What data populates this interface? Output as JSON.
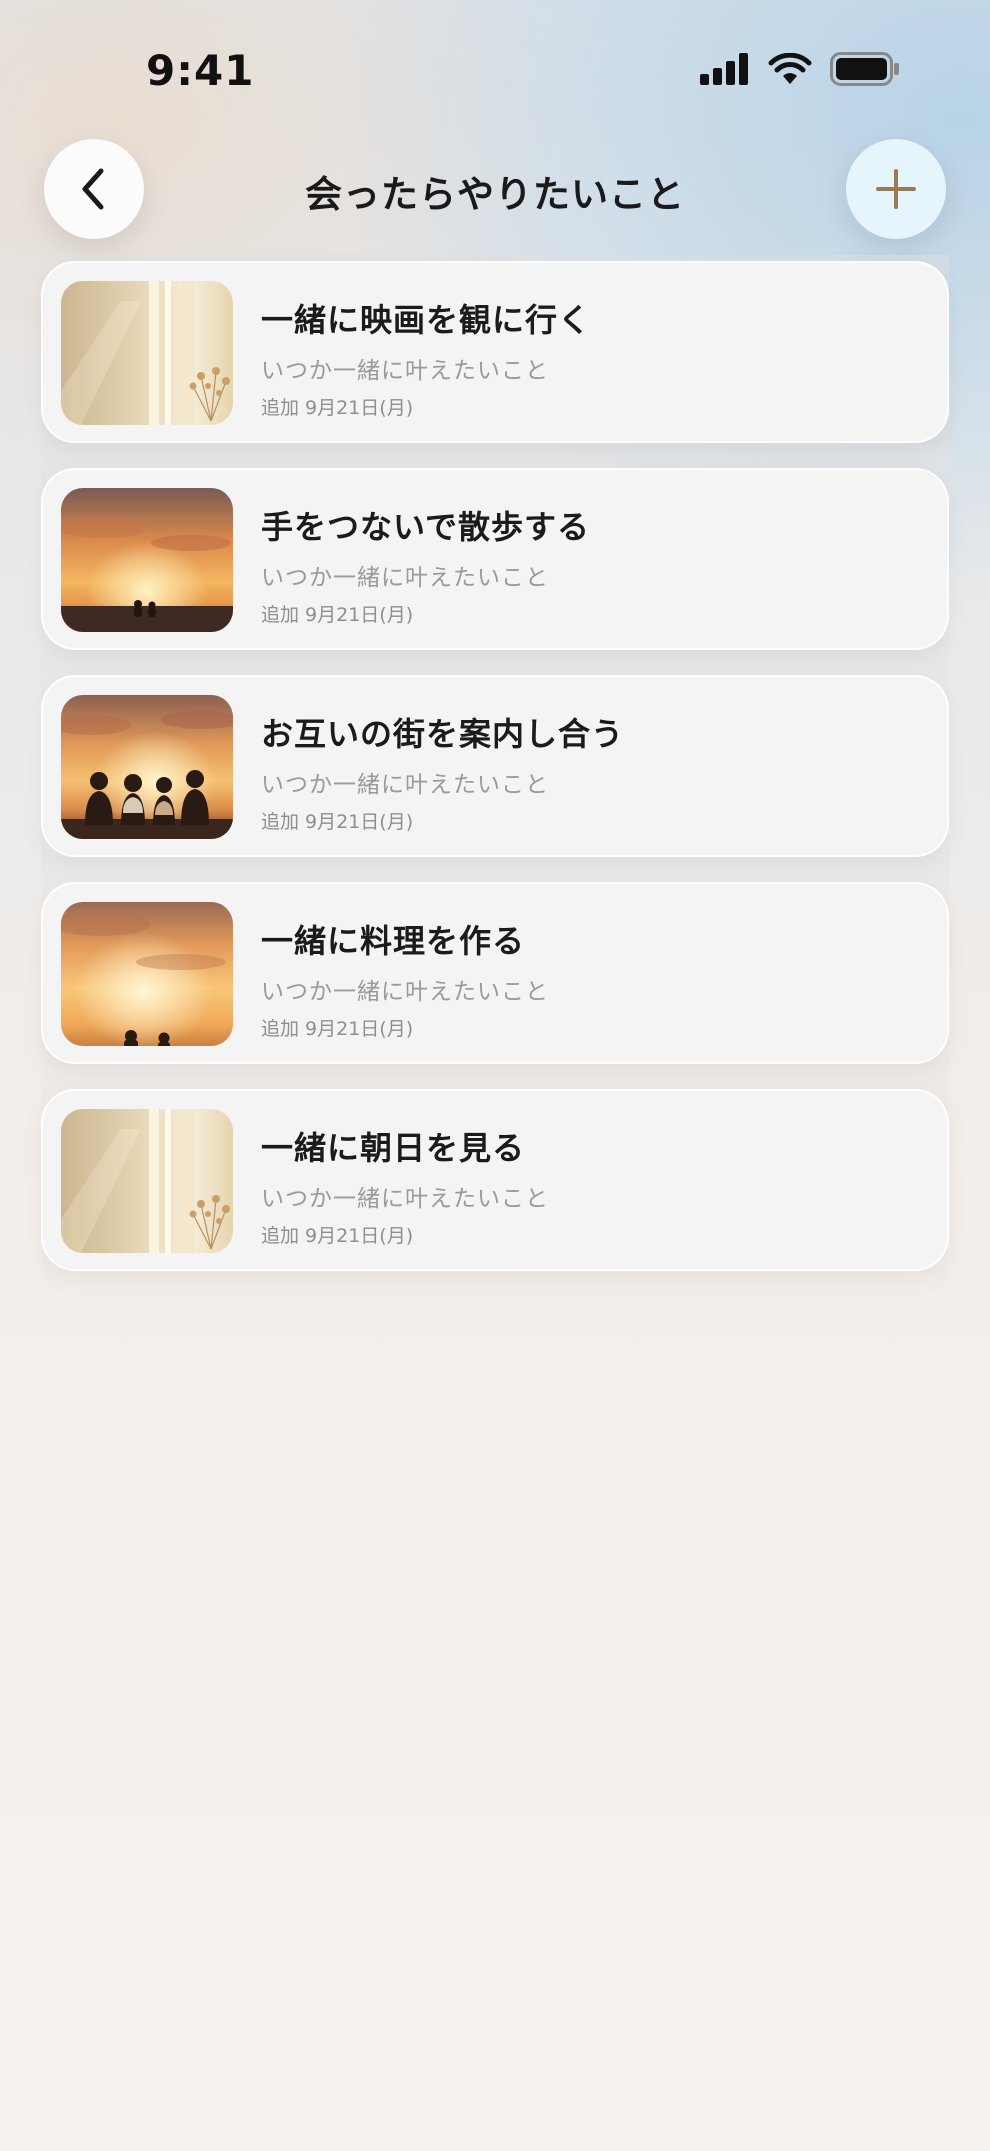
{
  "status_bar": {
    "time": "9:41"
  },
  "header": {
    "title": "会ったらやりたいこと"
  },
  "items": [
    {
      "title": "一緒に映画を観に行く",
      "subtitle": "いつか一緒に叶えたいこと",
      "date": "追加 9月21日(月)",
      "image": "window-curtain-flowers"
    },
    {
      "title": "手をつないで散歩する",
      "subtitle": "いつか一緒に叶えたいこと",
      "date": "追加 9月21日(月)",
      "image": "sunset-beach-couple"
    },
    {
      "title": "お互いの街を案内し合う",
      "subtitle": "いつか一緒に叶えたいこと",
      "date": "追加 9月21日(月)",
      "image": "sunset-group-of-four"
    },
    {
      "title": "一緒に料理を作る",
      "subtitle": "いつか一緒に叶えたいこと",
      "date": "追加 9月21日(月)",
      "image": "sunset-couple-horizon"
    },
    {
      "title": "一緒に朝日を見る",
      "subtitle": "いつか一緒に叶えたいこと",
      "date": "追加 9月21日(月)",
      "image": "window-curtain-flowers"
    }
  ],
  "icons": {
    "back": "chevron-left-icon",
    "add": "plus-icon",
    "signal": "signal-icon",
    "wifi": "wifi-icon",
    "battery": "battery-icon"
  },
  "colors": {
    "add_accent": "#9a7a55",
    "add_bg": "#e6f4fb"
  }
}
